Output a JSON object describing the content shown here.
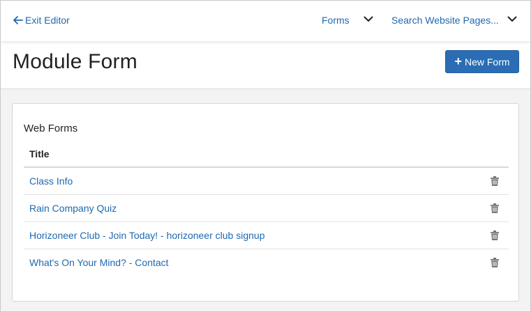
{
  "topbar": {
    "exit_label": "Exit Editor",
    "forms_label": "Forms",
    "search_label": "Search Website Pages..."
  },
  "header": {
    "title": "Module Form",
    "new_form_label": "New Form"
  },
  "card": {
    "title": "Web Forms",
    "column_title": "Title",
    "rows": [
      {
        "title": "Class Info"
      },
      {
        "title": "Rain Company Quiz"
      },
      {
        "title": "Horizoneer Club - Join Today! - horizoneer club signup"
      },
      {
        "title": "What's On Your Mind? - Contact"
      }
    ]
  },
  "icons": {
    "exit": "arrow-left-icon",
    "dropdown": "chevron-down-icon",
    "add": "plus-icon",
    "delete": "trash-icon"
  },
  "colors": {
    "link": "#1f68b0",
    "primary_button": "#2a6db5",
    "background": "#f3f3f3"
  }
}
